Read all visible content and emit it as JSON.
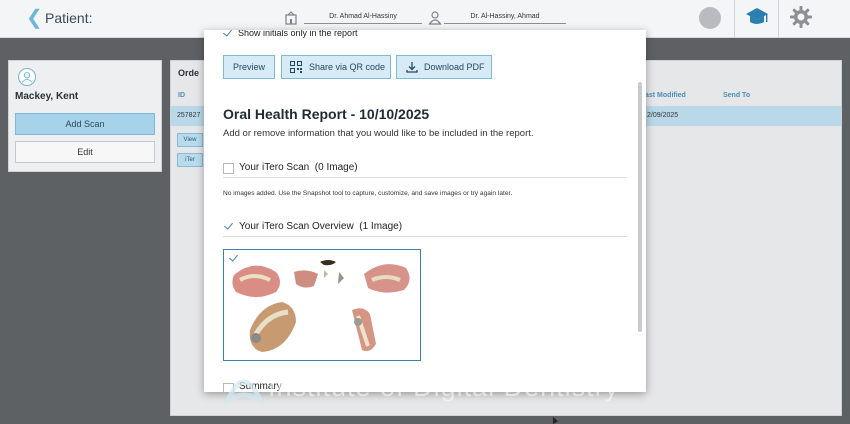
{
  "header": {
    "back_icon": "chevron-left-icon",
    "patient_label": "Patient:",
    "doctor_name": "Dr. Ahmad Al-Hassiny",
    "user_name": "Dr. Al-Hassiny, Ahmad"
  },
  "patient_card": {
    "name": "Mackey, Kent",
    "add_scan_label": "Add Scan",
    "edit_label": "Edit"
  },
  "orders": {
    "title": "Orde",
    "col_id": "ID",
    "col_last_modified": "ast Modified",
    "col_send_to": "Send To",
    "row_id": "257827",
    "row_last_modified": "2/09/2025",
    "view_label": "View",
    "itero_label": "iTer"
  },
  "modal": {
    "show_initials_label": "Show initials only in the report",
    "preview_label": "Preview",
    "share_qr_label": "Share via QR code",
    "download_pdf_label": "Download PDF",
    "report_title": "Oral Health Report - 10/10/2025",
    "report_subtitle": "Add or remove information that you would like to be included in the report.",
    "section_scan": {
      "title": "Your iTero Scan",
      "count": "(0 Image)",
      "checked": false,
      "note": "No images added. Use the Snapshot tool to capture, customize, and save images or try again later."
    },
    "section_overview": {
      "title": "Your iTero Scan Overview",
      "count": "(1 Image)",
      "checked": true
    },
    "summary_label": "Summary"
  },
  "watermark": "Institute of Digital Dentistry",
  "colors": {
    "accent": "#3d82b0",
    "button_fill": "#d7ebf6",
    "button_border": "#7fb9d8",
    "overlay": "#5e6164"
  }
}
